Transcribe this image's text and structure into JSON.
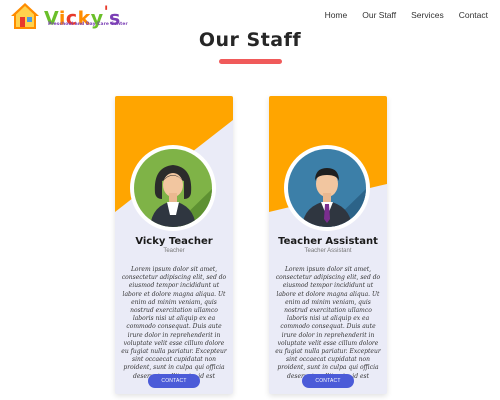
{
  "colors": {
    "accent_title_bar": "#f05a5a",
    "card_banner": "#ffa500",
    "card_background": "#eaebf7",
    "contact_button": "#4b5bd8"
  },
  "brand": {
    "logo_text_letters": [
      "V",
      "i",
      "c",
      "k",
      "y",
      "'",
      "s"
    ],
    "logo_letter_colors": [
      "#6abf2a",
      "#ff8c00",
      "#e8392b",
      "#ff8c00",
      "#6abf2a",
      "#e8392b",
      "#7b3fb5"
    ],
    "logo_subtitle": "Preschool and Day Care Center",
    "logo_icon": "house-icon"
  },
  "nav": {
    "items": [
      "Home",
      "Our Staff",
      "Services",
      "Contact"
    ]
  },
  "page": {
    "title": "Our Staff"
  },
  "staff": [
    {
      "name": "Vicky Teacher",
      "role": "Teacher",
      "avatar_icon": "female-teacher-avatar-icon",
      "description": "Lorem ipsum dolor sit amet, consectetur adipiscing elit, sed do eiusmod tempor incididunt ut labore et dolore magna aliqua. Ut enim ad minim veniam, quis nostrud exercitation ullamco laboris nisi ut aliquip ex ea commodo consequat. Duis aute irure dolor in reprehenderit in voluptate velit esse cillum dolore eu fugiat nulla pariatur. Excepteur sint occaecat cupidatat non proident, sunt in culpa qui officia deserunt mollit anim id est laborum",
      "button_label": "CONTACT"
    },
    {
      "name": "Teacher Assistant",
      "role": "Teacher Assistant",
      "avatar_icon": "male-assistant-avatar-icon",
      "description": "Lorem ipsum dolor sit amet, consectetur adipiscing elit, sed do eiusmod tempor incididunt ut labore et dolore magna aliqua. Ut enim ad minim veniam, quis nostrud exercitation ullamco laboris nisi ut aliquip ex ea commodo consequat. Duis aute irure dolor in reprehenderit in voluptate velit esse cillum dolore eu fugiat nulla pariatur. Excepteur sint occaecat cupidatat non proident, sunt in culpa qui officia deserunt mollit anim id est laborum",
      "button_label": "CONTACT"
    }
  ]
}
